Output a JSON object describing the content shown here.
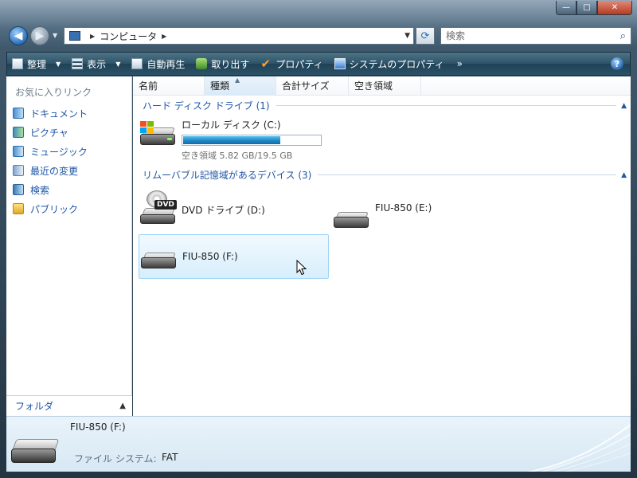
{
  "window": {
    "buttons": {
      "minimize": "—",
      "maximize": "□",
      "close": "✕"
    }
  },
  "address": {
    "crumbs": [
      "コンピュータ"
    ]
  },
  "search": {
    "placeholder": "検索"
  },
  "toolbar": {
    "organize": "整理",
    "views": "表示",
    "autoplay": "自動再生",
    "eject": "取り出す",
    "properties": "プロパティ",
    "system_properties": "システムのプロパティ",
    "more": "»"
  },
  "sidebar": {
    "title": "お気に入りリンク",
    "items": [
      {
        "label": "ドキュメント",
        "icon": "documents-icon"
      },
      {
        "label": "ピクチャ",
        "icon": "pictures-icon"
      },
      {
        "label": "ミュージック",
        "icon": "music-icon"
      },
      {
        "label": "最近の変更",
        "icon": "recent-changes-icon"
      },
      {
        "label": "検索",
        "icon": "searches-icon"
      },
      {
        "label": "パブリック",
        "icon": "public-folder-icon"
      }
    ],
    "folder_label": "フォルダ"
  },
  "columns": [
    "名前",
    "種類",
    "合計サイズ",
    "空き領域"
  ],
  "sorted_column": "種類",
  "groups": {
    "hard_disks": {
      "title": "ハード ディスク ドライブ (1)",
      "drives": [
        {
          "label": "ローカル ディスク (C:)",
          "free_text": "空き領域 5.82 GB/19.5 GB",
          "used_fraction": 0.7
        }
      ]
    },
    "removable": {
      "title": "リムーバブル記憶域があるデバイス (3)",
      "drives": [
        {
          "label": "DVD ドライブ (D:)"
        },
        {
          "label": "FIU-850 (E:)"
        },
        {
          "label": "FIU-850 (F:)",
          "selected": true
        }
      ]
    }
  },
  "details": {
    "name": "FIU-850 (F:)",
    "fs_label": "ファイル システム:",
    "fs_value": "FAT"
  },
  "colors": {
    "link": "#1d56a6",
    "selection_border": "#9fd3f5",
    "capacity_fill": "#1f87c6"
  }
}
